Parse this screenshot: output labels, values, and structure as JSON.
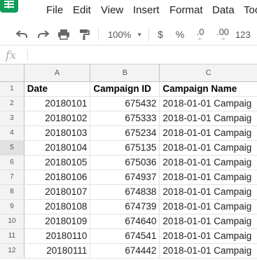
{
  "app": {
    "logo_icon": "sheets-logo-icon",
    "brand_color": "#0f9d58"
  },
  "menu": [
    "File",
    "Edit",
    "View",
    "Insert",
    "Format",
    "Data",
    "Too"
  ],
  "toolbar": {
    "undo_icon": "undo-icon",
    "redo_icon": "redo-icon",
    "print_icon": "print-icon",
    "paint_format_icon": "paint-format-icon",
    "zoom": "100%",
    "currency": "$",
    "percent": "%",
    "decrease_decimal": ".0",
    "increase_decimal": ".00",
    "more_formats": "123"
  },
  "formula_bar": {
    "fx": "fx",
    "value": ""
  },
  "columns": [
    "A",
    "B",
    "C"
  ],
  "rows": [
    {
      "n": "1",
      "date": "Date",
      "cid": "Campaign ID",
      "cname": "Campaign Name"
    },
    {
      "n": "2",
      "date": "20180101",
      "cid": "675432",
      "cname": "2018-01-01 Campaig"
    },
    {
      "n": "3",
      "date": "20180102",
      "cid": "675333",
      "cname": "2018-01-01 Campaig"
    },
    {
      "n": "4",
      "date": "20180103",
      "cid": "675234",
      "cname": "2018-01-01 Campaig"
    },
    {
      "n": "5",
      "date": "20180104",
      "cid": "675135",
      "cname": "2018-01-01 Campaig"
    },
    {
      "n": "6",
      "date": "20180105",
      "cid": "675036",
      "cname": "2018-01-01 Campaig"
    },
    {
      "n": "7",
      "date": "20180106",
      "cid": "674937",
      "cname": "2018-01-01 Campaig"
    },
    {
      "n": "8",
      "date": "20180107",
      "cid": "674838",
      "cname": "2018-01-01 Campaig"
    },
    {
      "n": "9",
      "date": "20180108",
      "cid": "674739",
      "cname": "2018-01-01 Campaig"
    },
    {
      "n": "10",
      "date": "20180109",
      "cid": "674640",
      "cname": "2018-01-01 Campaig"
    },
    {
      "n": "11",
      "date": "20180110",
      "cid": "674541",
      "cname": "2018-01-01 Campaig"
    },
    {
      "n": "12",
      "date": "20180111",
      "cid": "674442",
      "cname": "2018-01-01 Campaig"
    }
  ]
}
